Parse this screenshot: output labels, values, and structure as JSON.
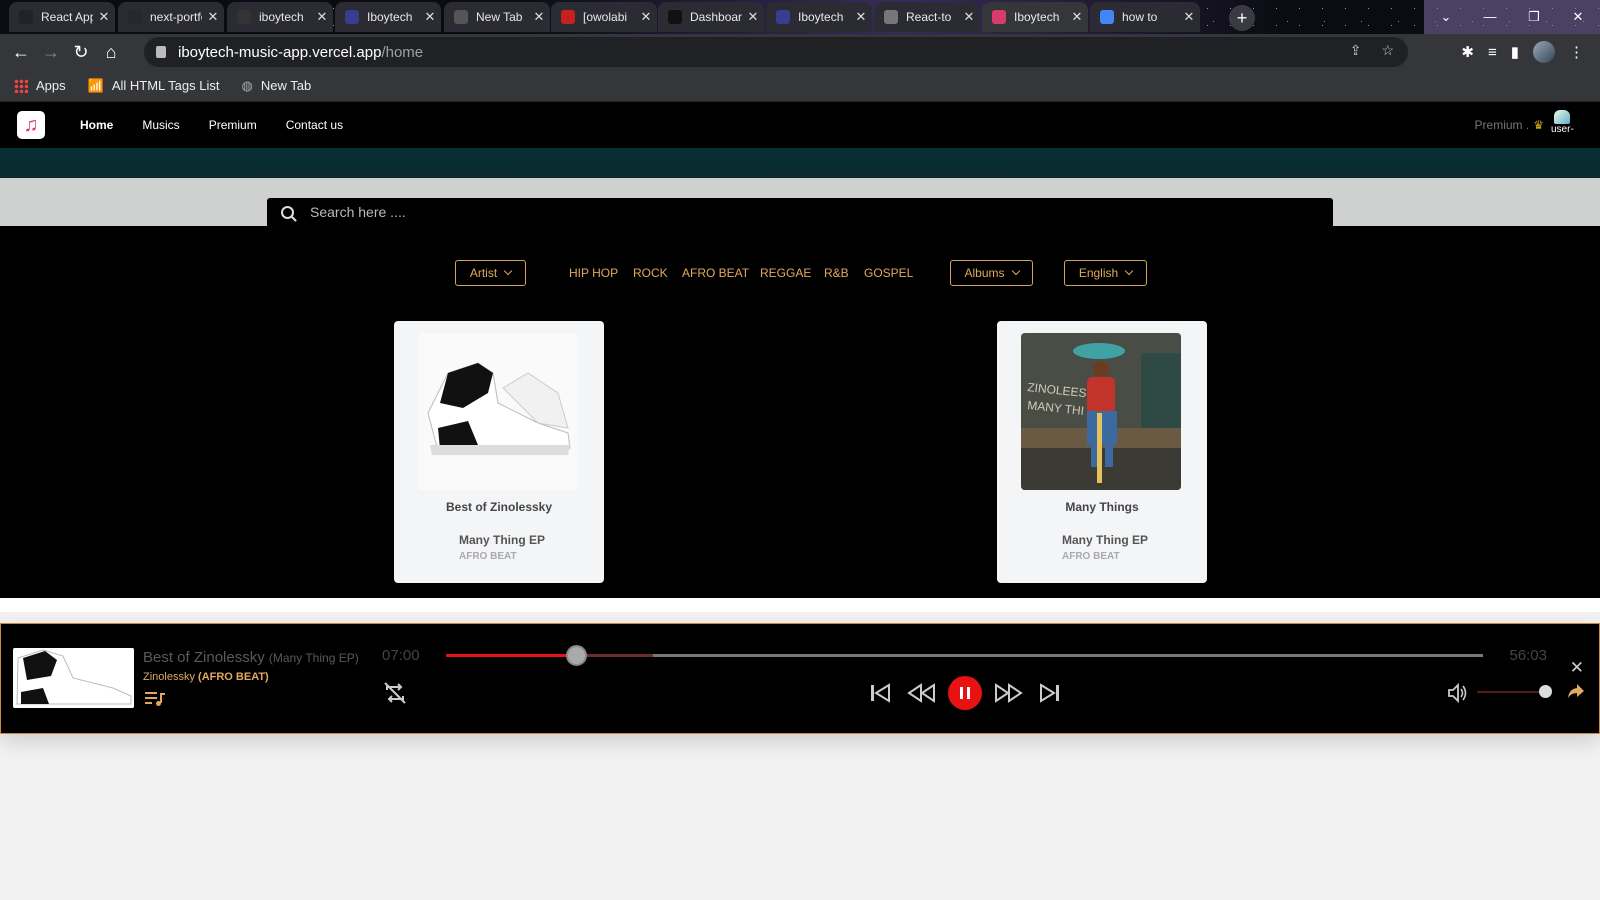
{
  "browser": {
    "tabs": [
      {
        "title": "React App",
        "color": "#20232a"
      },
      {
        "title": "next-portfolio",
        "color": "#24292e"
      },
      {
        "title": "iboytech",
        "color": "#333"
      },
      {
        "title": "Iboytech",
        "color": "#3b3b8f"
      },
      {
        "title": "New Tab",
        "color": "#555"
      },
      {
        "title": "[owolabi",
        "color": "#c5221f"
      },
      {
        "title": "Dashboard",
        "color": "#111"
      },
      {
        "title": "Iboytech",
        "color": "#3b3b8f"
      },
      {
        "title": "React-to",
        "color": "#777"
      },
      {
        "title": "Iboytech",
        "color": "#d93b6a"
      },
      {
        "title": "how to",
        "color": "#4285f4"
      }
    ],
    "url_host": "iboytech-music-app.vercel.app",
    "url_path": "/home",
    "bookmarks": [
      "Apps",
      "All HTML Tags List",
      "New Tab"
    ]
  },
  "site": {
    "nav": {
      "home": "Home",
      "musics": "Musics",
      "premium": "Premium",
      "contact": "Contact us"
    },
    "premium_label": "Premium .",
    "user_label": "user-",
    "search_placeholder": "Search here ....",
    "filters": {
      "artist": "Artist",
      "genres": [
        "HIP HOP",
        "ROCK",
        "AFRO BEAT",
        "REGGAE",
        "R&B",
        "GOSPEL"
      ],
      "albums": "Albums",
      "language": "English"
    },
    "cards": [
      {
        "title": "Best of Zinolessky",
        "album": "Many Thing EP",
        "genre": "AFRO BEAT"
      },
      {
        "title": "Many Things",
        "album": "Many Thing EP",
        "genre": "AFRO BEAT"
      }
    ]
  },
  "player": {
    "song": "Best of Zinolessky",
    "album": "(Many Thing EP)",
    "artist": "Zinolessky",
    "genre": "(AFRO BEAT)",
    "current_time": "07:00",
    "total_time": "56:03",
    "progress_fraction": 0.125,
    "buffered_fraction": 0.2,
    "volume_fraction": 1.0,
    "accent": "#e81212"
  }
}
